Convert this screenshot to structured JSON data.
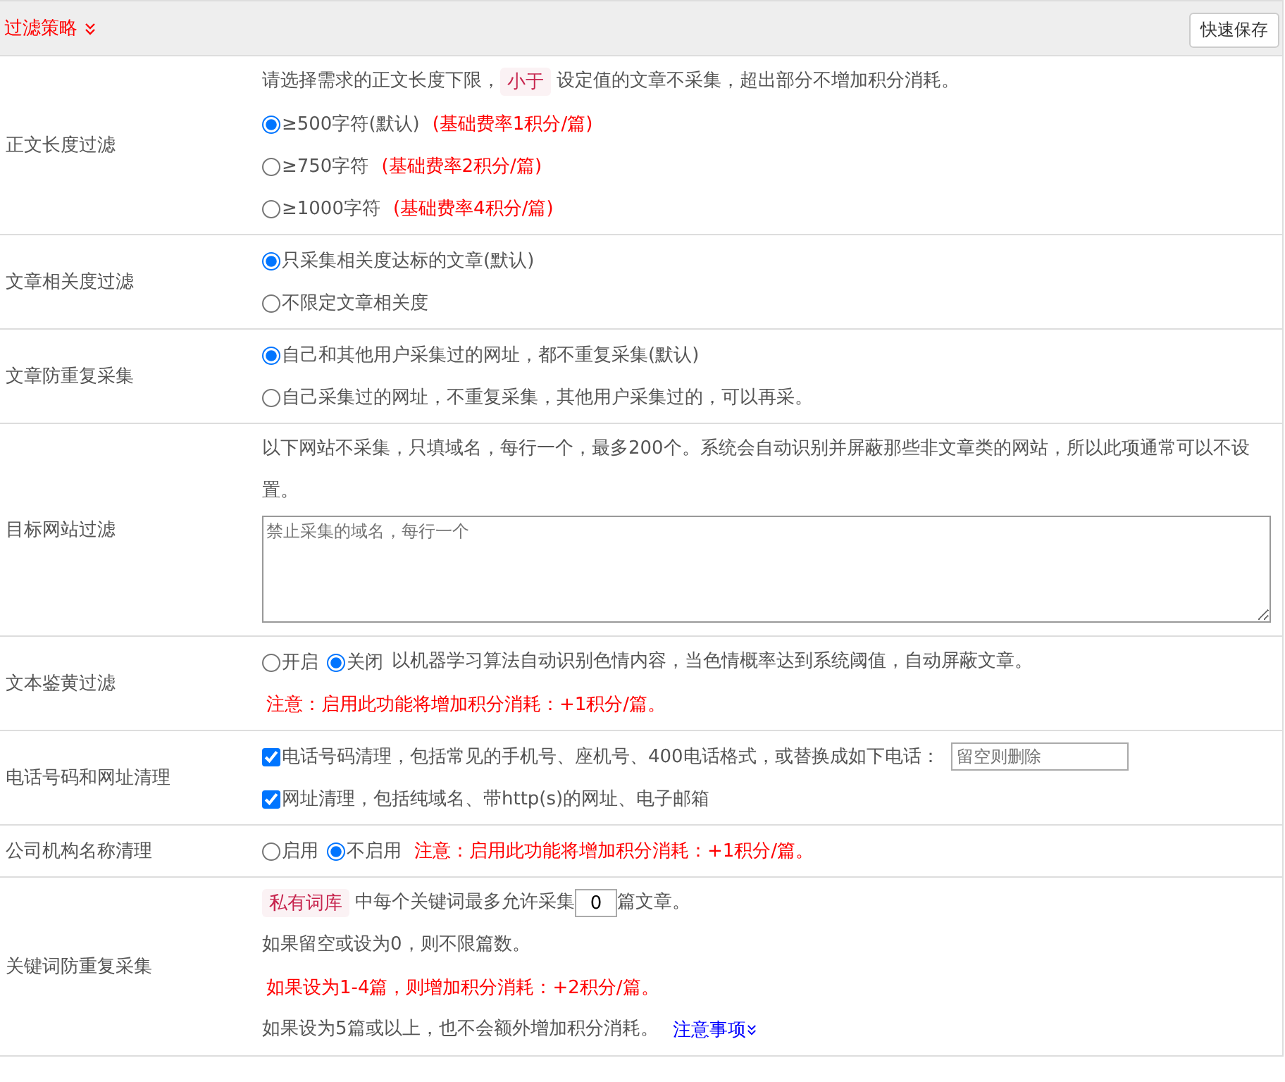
{
  "header": {
    "title": "过滤策略",
    "save_button": "快速保存"
  },
  "rows": [
    {
      "label": "正文长度过滤",
      "lines": [
        [
          {
            "kind": "text",
            "text": "请选择需求的正文长度下限，"
          },
          {
            "kind": "tag",
            "text": "小于"
          },
          {
            "kind": "text",
            "text": "设定值的文章不采集，超出部分不增加积分消耗。"
          }
        ],
        [
          {
            "kind": "radio",
            "text": "≥500字符(默认)",
            "selected": true
          },
          {
            "kind": "note",
            "text": "(基础费率1积分/篇)"
          }
        ],
        [
          {
            "kind": "radio",
            "text": "≥750字符",
            "selected": false
          },
          {
            "kind": "note",
            "text": "(基础费率2积分/篇)"
          }
        ],
        [
          {
            "kind": "radio",
            "text": "≥1000字符",
            "selected": false
          },
          {
            "kind": "note",
            "text": "(基础费率4积分/篇)"
          }
        ]
      ]
    },
    {
      "label": "文章相关度过滤",
      "lines": [
        [
          {
            "kind": "radio",
            "text": "只采集相关度达标的文章(默认)",
            "selected": true
          }
        ],
        [
          {
            "kind": "radio",
            "text": "不限定文章相关度",
            "selected": false
          }
        ]
      ]
    },
    {
      "label": "文章防重复采集",
      "lines": [
        [
          {
            "kind": "radio",
            "text": "自己和其他用户采集过的网址，都不重复采集(默认)",
            "selected": true
          }
        ],
        [
          {
            "kind": "radio",
            "text": "自己采集过的网址，不重复采集，其他用户采集过的，可以再采。",
            "selected": false
          }
        ]
      ]
    },
    {
      "label": "目标网站过滤",
      "lines": [
        [
          {
            "kind": "text",
            "text": "以下网站不采集，只填域名，每行一个，最多200个。系统会自动识别并屏蔽那些非文章类的网站，所以此项通常可以不设置。"
          }
        ],
        [
          {
            "kind": "textarea",
            "placeholder": "禁止采集的域名，每行一个"
          }
        ]
      ]
    },
    {
      "label": "文本鉴黄过滤",
      "lines": [
        [
          {
            "kind": "radio",
            "text": "开启",
            "selected": false
          },
          {
            "kind": "radio",
            "text": "关闭",
            "selected": true
          },
          {
            "kind": "text",
            "text": "以机器学习算法自动识别色情内容，当色情概率达到系统阈值，自动屏蔽文章。"
          }
        ],
        [
          {
            "kind": "note",
            "text": "注意：启用此功能将增加积分消耗：+1积分/篇。"
          }
        ]
      ]
    },
    {
      "label": "电话号码和网址清理",
      "lines": [
        [
          {
            "kind": "checkbox",
            "text": "电话号码清理，包括常见的手机号、座机号、400电话格式，或替换成如下电话：",
            "checked": true
          },
          {
            "kind": "field",
            "placeholder": "留空则删除"
          }
        ],
        [
          {
            "kind": "checkbox",
            "text": "网址清理，包括纯域名、带http(s)的网址、电子邮箱",
            "checked": true
          }
        ]
      ]
    },
    {
      "label": "公司机构名称清理",
      "lines": [
        [
          {
            "kind": "radio",
            "text": "启用",
            "selected": false
          },
          {
            "kind": "radio",
            "text": "不启用",
            "selected": true
          },
          {
            "kind": "note",
            "text": "注意：启用此功能将增加积分消耗：+1积分/篇。"
          }
        ]
      ]
    },
    {
      "label": "关键词防重复采集",
      "lines": [
        [
          {
            "kind": "tag",
            "text": "私有词库"
          },
          {
            "kind": "text",
            "text": "中每个关键词最多允许采集"
          },
          {
            "kind": "number",
            "value": "0"
          },
          {
            "kind": "text",
            "text": "篇文章。"
          }
        ],
        [
          {
            "kind": "text",
            "text": "如果留空或设为0，则不限篇数。"
          }
        ],
        [
          {
            "kind": "note",
            "text": "如果设为1-4篇，则增加积分消耗：+2积分/篇。"
          }
        ],
        [
          {
            "kind": "text",
            "text": "如果设为5篇或以上，也不会额外增加积分消耗。"
          },
          {
            "kind": "link",
            "text": "注意事项"
          }
        ]
      ]
    }
  ]
}
